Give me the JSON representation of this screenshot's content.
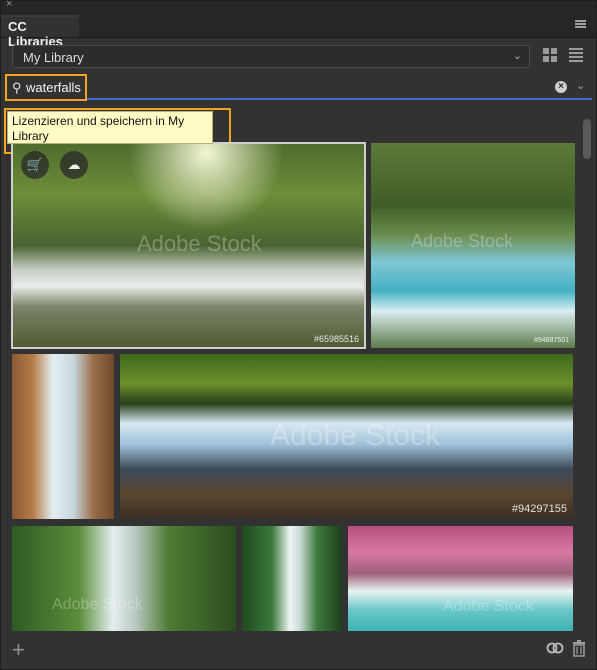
{
  "panel": {
    "close_glyph": "×",
    "tab_title": "CC Libraries",
    "library_select": {
      "value": "My Library"
    },
    "search": {
      "value": "waterfalls"
    },
    "tooltip": "Lizenzieren und speichern in My Library"
  },
  "thumbnails": [
    {
      "watermark": "Adobe Stock",
      "id_label": "#65985516",
      "selected": true
    },
    {
      "watermark": "Adobe Stock",
      "id_label": "#94887501"
    },
    {
      "watermark": "",
      "id_label": ""
    },
    {
      "watermark": "Adobe Stock",
      "id_label": "#94297155"
    },
    {
      "watermark": "Adobe Stock",
      "id_label": ""
    },
    {
      "watermark": "",
      "id_label": ""
    },
    {
      "watermark": "Adobe Stock",
      "id_label": ""
    }
  ],
  "icons": {
    "close": "close-icon",
    "panel_menu": "hamburger-menu-icon",
    "dropdown": "chevron-down-icon",
    "grid_view": "grid-view-icon",
    "list_view": "list-view-icon",
    "search": "search-icon",
    "clear": "clear-search-icon",
    "filter": "chevron-down-icon",
    "license": "cart-add-icon",
    "save": "cloud-upload-icon",
    "add": "plus-icon",
    "creative_cloud": "creative-cloud-icon",
    "delete": "trash-icon"
  },
  "colors": {
    "panel_bg": "#323232",
    "highlight": "#f1a21e",
    "search_underline": "#3d6fc4",
    "tooltip_bg": "#fffbc4"
  }
}
